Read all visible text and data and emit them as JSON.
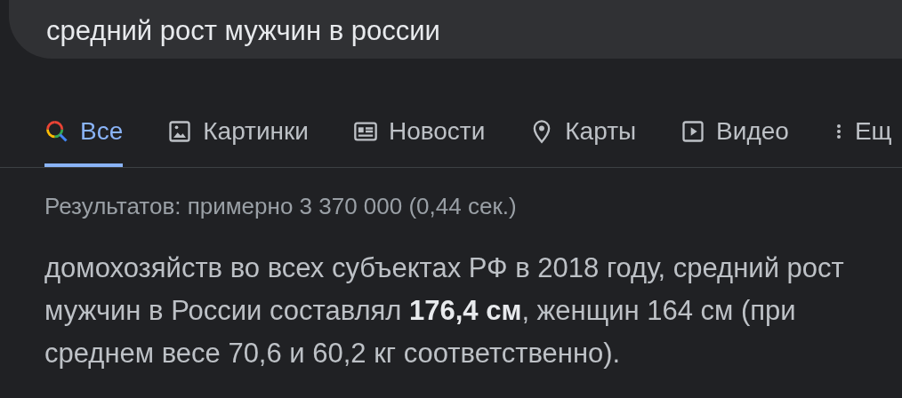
{
  "search": {
    "value": "средний рост мужчин в россии"
  },
  "tabs": [
    {
      "label": "Все",
      "kind": "search",
      "selected": true
    },
    {
      "label": "Картинки",
      "kind": "images",
      "selected": false
    },
    {
      "label": "Новости",
      "kind": "news",
      "selected": false
    },
    {
      "label": "Карты",
      "kind": "maps",
      "selected": false
    },
    {
      "label": "Видео",
      "kind": "video",
      "selected": false
    },
    {
      "label": "Ещ",
      "kind": "more",
      "selected": false
    }
  ],
  "result_stats": "Результатов: примерно 3 370 000 (0,44 сек.)",
  "snippet": "домохозяйств во всех субъектах РФ в 2018 году, средний рост мужчин в России составлял **176,4 см**, женщин 164 см (при среднем весе 70,6 и 60,2 кг соответственно)."
}
